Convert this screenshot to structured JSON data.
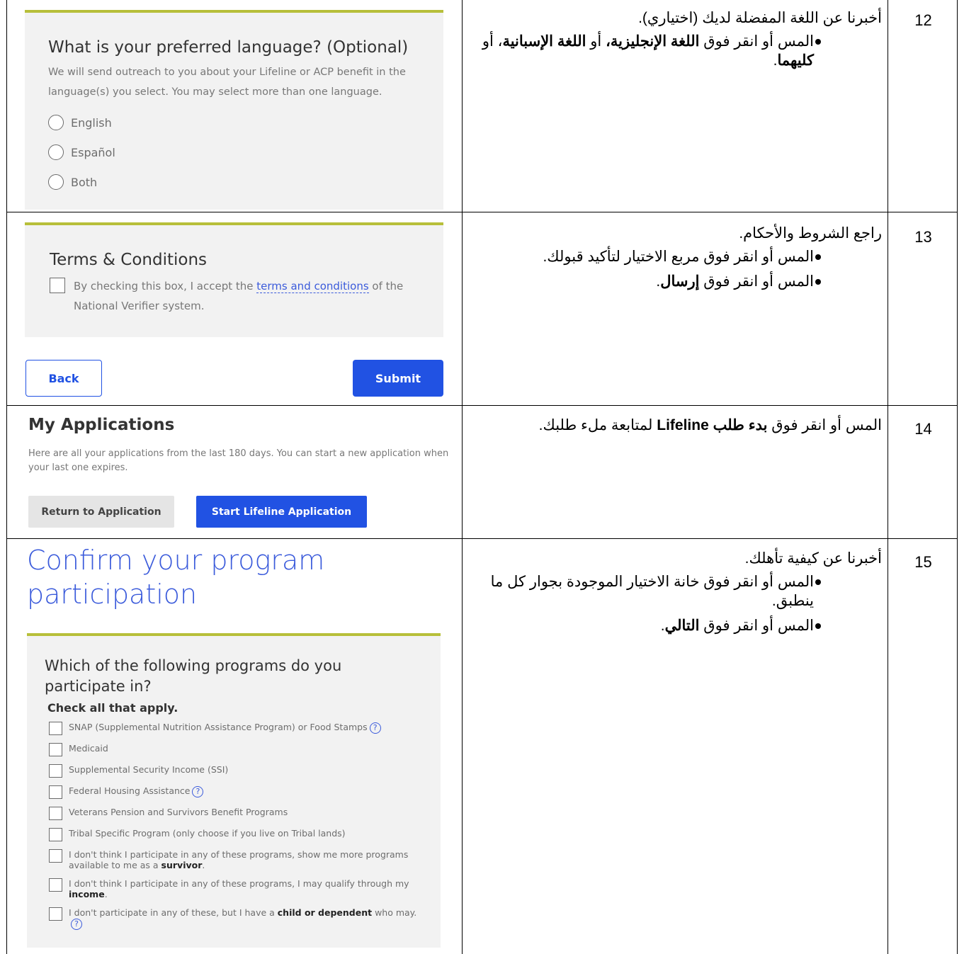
{
  "rows": [
    {
      "num": "12",
      "ar_head": "أخبرنا عن اللغة المفضلة لديك (اختياري).",
      "ar_b1": [
        "المس أو انقر فوق ",
        "اللغة الإنجليزية، ",
        "أو ",
        "اللغة الإسبانية",
        "، أو ",
        "كليهما",
        "."
      ],
      "ui": {
        "question": "What is your preferred language? (Optional)",
        "desc": "We will send outreach to you about your Lifeline or ACP benefit in the language(s) you select. You may select more than one language.",
        "options": [
          "English",
          "Español",
          "Both"
        ]
      }
    },
    {
      "num": "13",
      "ar_head": "راجع الشروط والأحكام.",
      "ar_b1": "المس أو انقر فوق مربع الاختيار لتأكيد قبولك.",
      "ar_b2": [
        "المس أو انقر فوق ",
        "إرسال",
        "."
      ],
      "ui": {
        "title": "Terms & Conditions",
        "text_pre": "By checking this box, I accept the ",
        "link": "terms and conditions",
        "text_post": " of the National Verifier system.",
        "back": "Back",
        "submit": "Submit"
      }
    },
    {
      "num": "14",
      "ar": [
        "المس أو انقر فوق ",
        "بدء طلب Lifeline",
        " لمتابعة ملء طلبك."
      ],
      "ui": {
        "title": "My Applications",
        "desc": "Here are all your applications from the last 180 days. You can start a new application when your last one expires.",
        "return_btn": "Return to Application",
        "start_btn": "Start Lifeline Application"
      }
    },
    {
      "num": "15",
      "ar_head": "أخبرنا عن كيفية تأهلك.",
      "ar_b1": "المس أو انقر فوق خانة الاختيار الموجودة بجوار كل ما ينطبق.",
      "ar_b2": [
        "المس أو انقر فوق ",
        "التالي",
        "."
      ],
      "ui": {
        "heading": "Confirm your program participation",
        "question": "Which of the following programs do you participate in?",
        "check_all": "Check all that apply.",
        "programs": [
          {
            "pre": "SNAP (Supplemental Nutrition Assistance Program) or Food Stamps",
            "bold": "",
            "post": "",
            "help": true
          },
          {
            "pre": "Medicaid",
            "bold": "",
            "post": "",
            "help": false
          },
          {
            "pre": "Supplemental Security Income (SSI)",
            "bold": "",
            "post": "",
            "help": false
          },
          {
            "pre": "Federal Housing Assistance",
            "bold": "",
            "post": "",
            "help": true
          },
          {
            "pre": "Veterans Pension and Survivors Benefit Programs",
            "bold": "",
            "post": "",
            "help": false
          },
          {
            "pre": "Tribal Specific Program (only choose if you live on Tribal lands)",
            "bold": "",
            "post": "",
            "help": false
          },
          {
            "pre": "I don't think I participate in any of these programs, show me more programs available to me as a ",
            "bold": "survivor",
            "post": ".",
            "help": false
          },
          {
            "pre": "I don't think I participate in any of these programs, I may qualify through my ",
            "bold": "income",
            "post": ".",
            "help": false
          },
          {
            "pre": "I don't participate in any of these, but I have a ",
            "bold": "child or dependent",
            "post": " who may.",
            "help": true
          }
        ]
      }
    }
  ],
  "colors": {
    "accent_line": "#b7bf3a",
    "primary_button": "#2152e3",
    "link": "#3b5bdb"
  }
}
